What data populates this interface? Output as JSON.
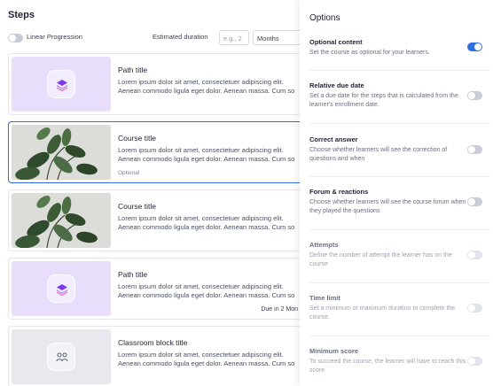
{
  "steps": {
    "title": "Steps",
    "linear_progression_label": "Linear Progression",
    "estimated_duration_label": "Estimated duration",
    "duration_placeholder": "e.g., 2",
    "duration_unit": "Months",
    "cards": [
      {
        "type": "path",
        "title": "Path title",
        "desc_line1": "Lorem ipsum dolor sit amet, consectetuer adipiscing elit.",
        "desc_line2": "Aenean commodo ligula eget dolor. Aenean massa. Cum so",
        "meta": "",
        "due": "",
        "icon": "layers-icon"
      },
      {
        "type": "course",
        "title": "Course title",
        "desc_line1": "Lorem ipsum dolor sit amet, consectetuer adipiscing elit.",
        "desc_line2": "Aenean commodo ligula eget dolor. Aenean massa. Cum so",
        "meta": "Optional",
        "due": "",
        "icon": "plant-image"
      },
      {
        "type": "course",
        "title": "Course title",
        "desc_line1": "Lorem ipsum dolor sit amet, consectetuer adipiscing elit.",
        "desc_line2": "Aenean commodo ligula eget dolor. Aenean massa. Cum so",
        "meta": "",
        "due": "",
        "icon": "plant-image"
      },
      {
        "type": "path",
        "title": "Path title",
        "desc_line1": "Lorem ipsum dolor sit amet, consectetuer adipiscing elit.",
        "desc_line2": "Aenean commodo ligula eget dolor. Aenean massa. Cum so",
        "meta": "",
        "due": "Due in 2 Mon",
        "icon": "layers-icon"
      },
      {
        "type": "classroom",
        "title": "Classroom block title",
        "desc_line1": "Lorem ipsum dolor sit amet, consectetuer adipiscing elit.",
        "desc_line2": "Aenean commodo ligula eget dolor. Aenean massa. Cum so",
        "meta": "",
        "due": "",
        "icon": "classroom-icon"
      }
    ]
  },
  "options": {
    "title": "Options",
    "items": [
      {
        "label": "Optional content",
        "desc": "Set the course as optional for your learners.",
        "enabled": true,
        "disabled": false
      },
      {
        "label": "Relative due date",
        "desc": "Set a due date for the steps that is calculated from the learner's enrollment date.",
        "enabled": false,
        "disabled": false
      },
      {
        "label": "Correct answer",
        "desc": "Choose whether learners will see the correction of questions and when",
        "enabled": false,
        "disabled": false
      },
      {
        "label": "Forum & reactions",
        "desc": "Choose whether learners will see the course forum when they played the questions",
        "enabled": false,
        "disabled": false
      },
      {
        "label": "Attempts",
        "desc": "Define the number of attempt the learner has on the course",
        "enabled": false,
        "disabled": true
      },
      {
        "label": "Time limit",
        "desc": "Set a minimum or maximum duration to complete the course.",
        "enabled": false,
        "disabled": true
      },
      {
        "label": "Minimum score",
        "desc": "To succeed the course, the learner will have to reach this score",
        "enabled": false,
        "disabled": true
      }
    ]
  },
  "colors": {
    "accent": "#2f6fe0",
    "path_bg": "#e8defc",
    "path_icon": "#7c3aed",
    "classroom_bg": "#e7e9ef"
  }
}
